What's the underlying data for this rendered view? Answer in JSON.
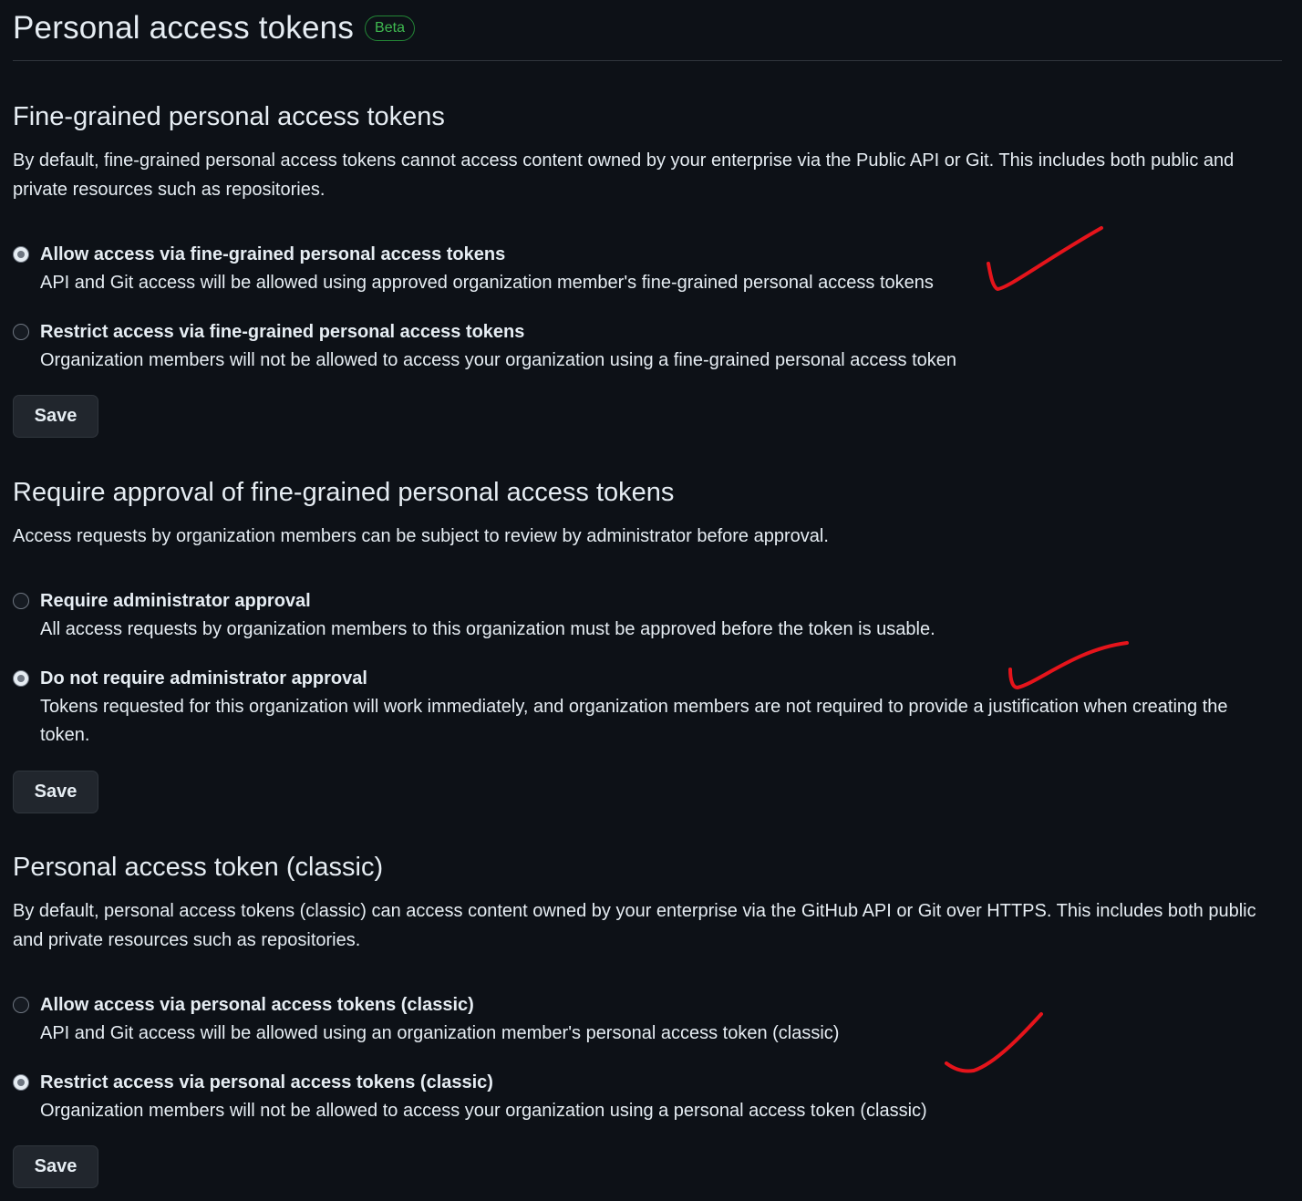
{
  "header": {
    "title": "Personal access tokens",
    "badge": "Beta"
  },
  "fine_grained": {
    "title": "Fine-grained personal access tokens",
    "description": "By default, fine-grained personal access tokens cannot access content owned by your enterprise via the Public API or Git. This includes both public and private resources such as repositories.",
    "options": [
      {
        "label": "Allow access via fine-grained personal access tokens",
        "note": "API and Git access will be allowed using approved organization member's fine-grained personal access tokens",
        "checked": true
      },
      {
        "label": "Restrict access via fine-grained personal access tokens",
        "note": "Organization members will not be allowed to access your organization using a fine-grained personal access token",
        "checked": false
      }
    ],
    "save_label": "Save"
  },
  "approval": {
    "title": "Require approval of fine-grained personal access tokens",
    "description": "Access requests by organization members can be subject to review by administrator before approval.",
    "options": [
      {
        "label": "Require administrator approval",
        "note": "All access requests by organization members to this organization must be approved before the token is usable.",
        "checked": false
      },
      {
        "label": "Do not require administrator approval",
        "note": "Tokens requested for this organization will work immediately, and organization members are not required to provide a justification when creating the token.",
        "checked": true
      }
    ],
    "save_label": "Save"
  },
  "classic": {
    "title": "Personal access token (classic)",
    "description": "By default, personal access tokens (classic) can access content owned by your enterprise via the GitHub API or Git over HTTPS. This includes both public and private resources such as repositories.",
    "options": [
      {
        "label": "Allow access via personal access tokens (classic)",
        "note": "API and Git access will be allowed using an organization member's personal access token (classic)",
        "checked": false
      },
      {
        "label": "Restrict access via personal access tokens (classic)",
        "note": "Organization members will not be allowed to access your organization using a personal access token (classic)",
        "checked": true
      }
    ],
    "save_label": "Save"
  },
  "colors": {
    "background": "#0d1117",
    "text": "#e6edf3",
    "beta_green": "#3fb950",
    "annotation_red": "#e5141b"
  }
}
